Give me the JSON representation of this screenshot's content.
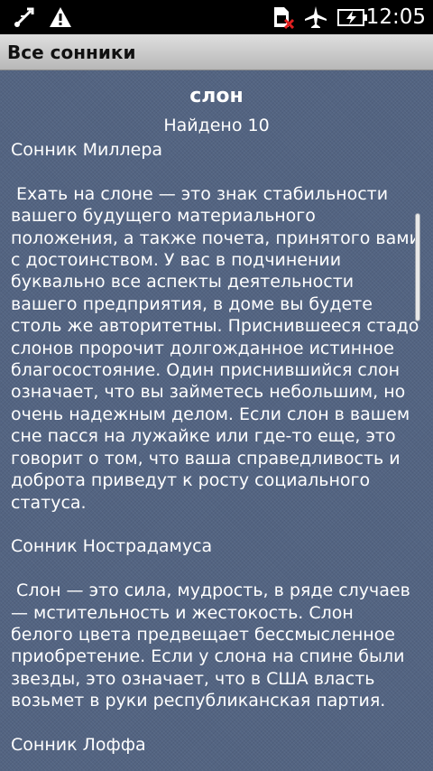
{
  "status_bar": {
    "time": "12:05",
    "icons": [
      "usb-debug-icon",
      "warning-icon",
      "no-sim-icon",
      "airplane-mode-icon",
      "battery-charging-icon"
    ]
  },
  "title_bar": {
    "title": "Все сонники"
  },
  "result": {
    "word": "слон",
    "found": "Найдено 10",
    "text": "Сонник Миллера\n\n Ехать на слоне — это знак стабильности вашего будущего материального положения, а также почета, принятого вами с достоинством. У вас в подчинении буквально все аспекты деятельности вашего предприятия, в доме вы будете столь же авторитетны. Приснившееся стадо слонов пророчит долгожданное истинное благосостояние. Один приснившийся слон означает, что вы займетесь небольшим, но очень надежным делом. Если слон в вашем сне пасся на лужайке или где-то еще, это говорит о том, что ваша справедливость и доброта приведут к росту социального статуса.\n\nСонник Нострадамуса\n\n Слон — это сила, мудрость, в ряде случаев — мстительность и жестокость. Слон белого цвета предвещает бессмысленное приобретение. Если у слона на спине были звезды, это означает, что в США власть возьмет в руки республиканская партия.\n\nСонник Лоффа"
  },
  "colors": {
    "status_bar_bg": "#000000",
    "title_bar_bg": "#c8c8c8",
    "content_bg": "#536482",
    "text": "#ffffff"
  }
}
